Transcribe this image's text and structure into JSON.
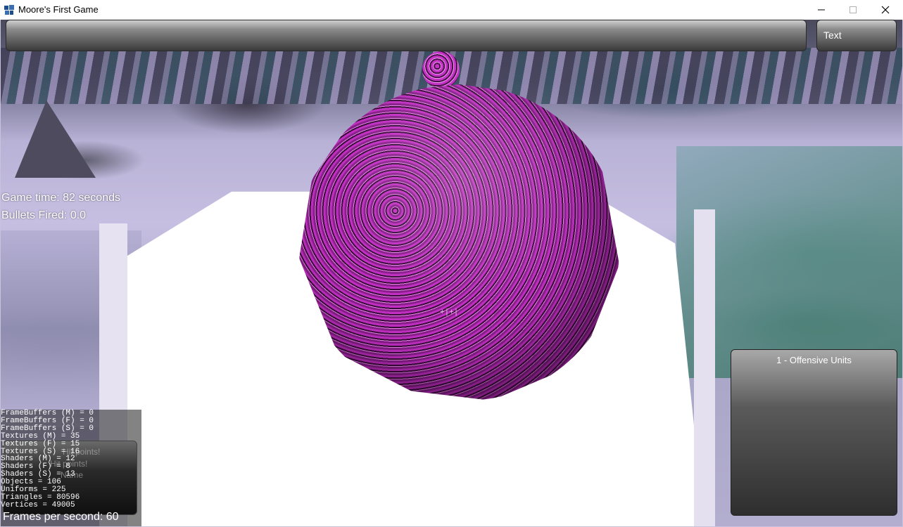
{
  "window": {
    "title": "Moore's First Game",
    "icon": "app-icon",
    "controls": [
      "minimize-icon",
      "maximize-icon",
      "close-icon"
    ]
  },
  "hud": {
    "top_button_label": "Text",
    "game_time": "Game time: 82 seconds",
    "bullets_fired": "Bullets Fired: 0.0",
    "crosshair": "+|+|",
    "ghost_lines": [
      "Hit points!",
      "Hit points!",
      "Name"
    ]
  },
  "stats": [
    "FrameBuffers (M) = 0",
    "FrameBuffers (F) = 0",
    "FrameBuffers (S) = 0",
    "Textures (M) = 35",
    "Textures (F) = 15",
    "Textures (S) = 16",
    "Shaders (M) = 12",
    "Shaders (F) = 8",
    "Shaders (S) = 13",
    "Objects = 106",
    "Uniforms = 225",
    "Triangles = 80596",
    "Vertices = 49005"
  ],
  "fps": "Frames per second: 60",
  "units_panel": {
    "title": "1 - Offensive Units"
  },
  "colors": {
    "sphere": "#b02db3",
    "hud_text": "#ffffff",
    "panel_dark": "#2e2e2e"
  }
}
